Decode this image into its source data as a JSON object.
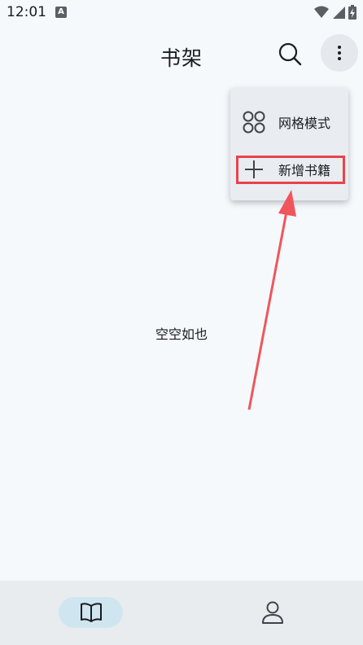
{
  "status_bar": {
    "time": "12:01",
    "notification_icon": "A"
  },
  "header": {
    "title": "书架"
  },
  "main": {
    "empty_text": "空空如也"
  },
  "menu": {
    "items": [
      {
        "label": "网格模式",
        "icon": "grid-icon"
      },
      {
        "label": "新增书籍",
        "icon": "plus-icon"
      }
    ]
  },
  "bottom_nav": {
    "items": [
      {
        "icon": "book-icon",
        "selected": true
      },
      {
        "icon": "person-icon",
        "selected": false
      }
    ]
  },
  "colors": {
    "background": "#f5f9fc",
    "highlight": "#e8434c",
    "nav_selected": "#cfe6f1",
    "menu_bg": "#e9edf1"
  }
}
